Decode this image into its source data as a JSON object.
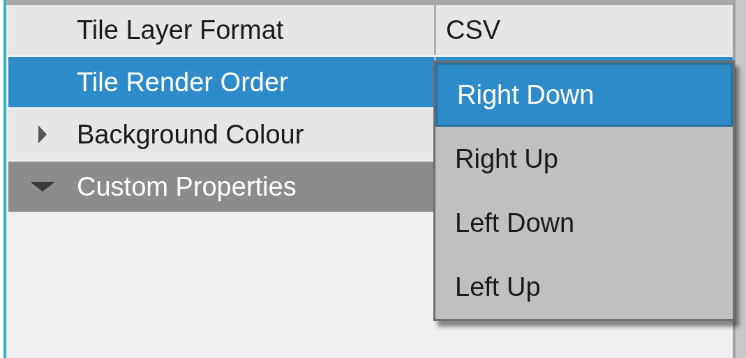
{
  "properties": [
    {
      "kind": "property",
      "name": "Tile Layer Format",
      "value": "CSV",
      "selected": false
    },
    {
      "kind": "property",
      "name": "Tile Render Order",
      "selected": true
    },
    {
      "kind": "expandable",
      "name": "Background Colour",
      "selected": false,
      "expanded": false
    },
    {
      "kind": "group",
      "name": "Custom Properties",
      "selected": false,
      "expanded": true
    }
  ],
  "dropdown": {
    "items": [
      {
        "label": "Right Down",
        "selected": true
      },
      {
        "label": "Right Up",
        "selected": false
      },
      {
        "label": "Left Down",
        "selected": false
      },
      {
        "label": "Left Up",
        "selected": false
      }
    ]
  }
}
